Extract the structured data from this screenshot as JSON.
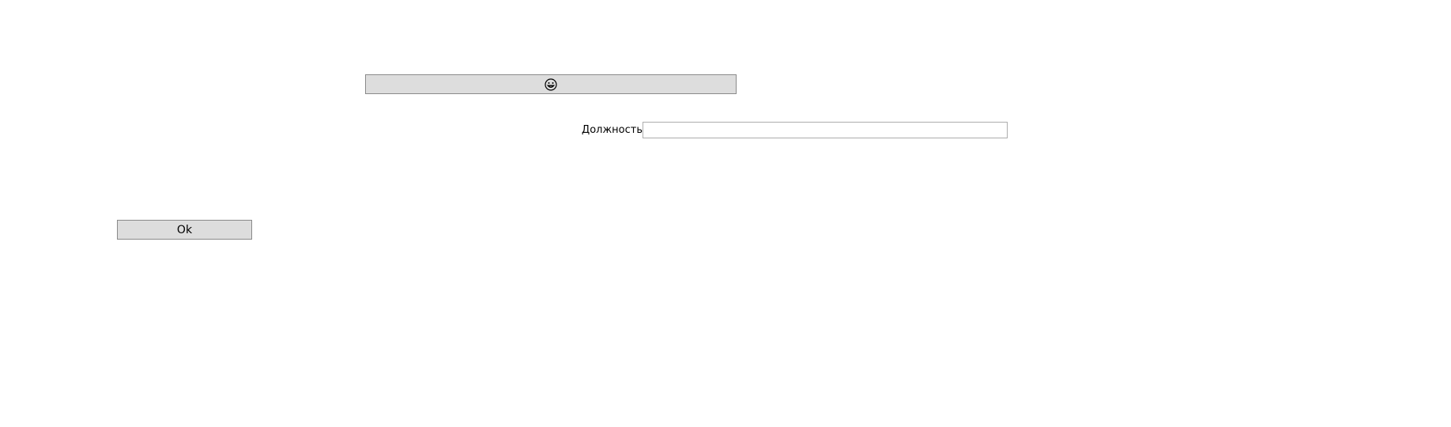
{
  "form": {
    "emoji_button": {
      "icon": "grinning-face-icon"
    },
    "position_field": {
      "label": "Должность",
      "value": "",
      "placeholder": ""
    },
    "ok_button": {
      "label": "Ok"
    }
  },
  "colors": {
    "button_background": "#dddddd",
    "button_border": "#8a8a8a",
    "input_border": "#adadad",
    "page_background": "#ffffff"
  }
}
